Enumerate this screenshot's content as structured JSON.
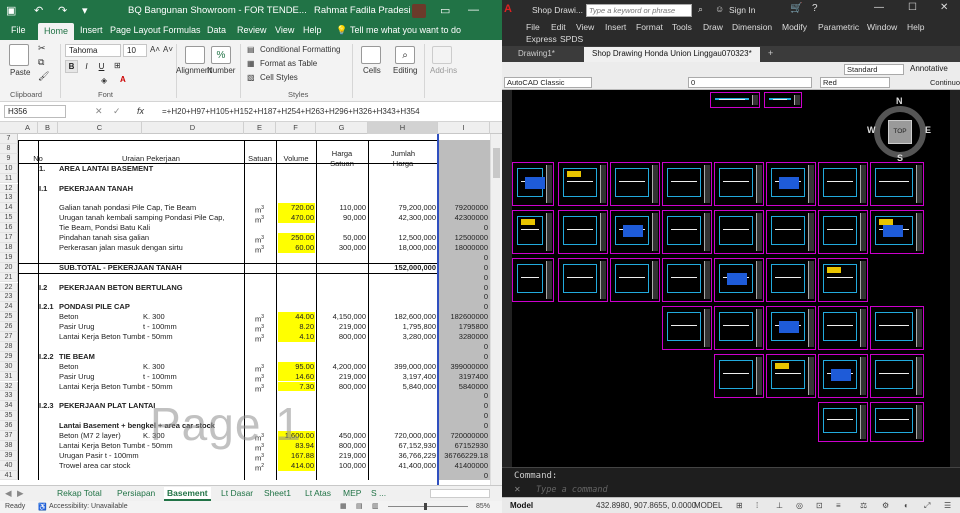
{
  "excel": {
    "title": "BQ Bangunan Showroom - FOR TENDE...",
    "user": "Rahmat Fadila Pradesi",
    "tabs": [
      "File",
      "Home",
      "Insert",
      "Page Layout",
      "Formulas",
      "Data",
      "Review",
      "View",
      "Help"
    ],
    "tell_me": "Tell me what you want to do",
    "ribbon": {
      "paste": "Paste",
      "clipboard": "Clipboard",
      "font_name": "Tahoma",
      "font_size": "10",
      "font": "Font",
      "alignment": "Alignment",
      "number": "Number",
      "cond_format": "Conditional Formatting",
      "format_table": "Format as Table",
      "cell_styles": "Cell Styles",
      "styles": "Styles",
      "cells": "Cells",
      "editing": "Editing",
      "addins": "Add-ins"
    },
    "name_box": "H356",
    "formula": "=+H20+H97+H105+H152+H187+H254+H263+H296+H326+H343+H354",
    "columns": [
      "A",
      "B",
      "C",
      "D",
      "E",
      "F",
      "G",
      "H",
      "I"
    ],
    "header": {
      "no": "No",
      "uraian": "Uraian Pekerjaan",
      "satuan": "Satuan",
      "volume": "Volume",
      "harga_satuan_1": "Harga",
      "harga_satuan_2": "Satuan",
      "jumlah_1": "Jumlah",
      "jumlah_2": "Harga"
    },
    "rows": [
      {
        "r": "7",
        "a": "",
        "b": "",
        "c": "",
        "d": "",
        "e": "",
        "f": "",
        "g": "",
        "h": "",
        "i": ""
      },
      {
        "r": "8",
        "a": "",
        "b": "",
        "c": "",
        "d": "",
        "e": "",
        "f": "",
        "g": "",
        "h": "",
        "i": ""
      },
      {
        "r": "9",
        "a": "",
        "b": "",
        "c": "",
        "d": "",
        "e": "",
        "f": "",
        "g": "",
        "h": "",
        "i": ""
      },
      {
        "r": "10",
        "a": "",
        "b": "1.",
        "c": "AREA LANTAI BASEMENT",
        "d": "",
        "e": "",
        "f": "",
        "g": "",
        "h": "",
        "i": ""
      },
      {
        "r": "11",
        "a": "",
        "b": "",
        "c": "",
        "d": "",
        "e": "",
        "f": "",
        "g": "",
        "h": "",
        "i": ""
      },
      {
        "r": "12",
        "a": "",
        "b": "I.1",
        "c": "PEKERJAAN TANAH",
        "d": "",
        "e": "",
        "f": "",
        "g": "",
        "h": "",
        "i": ""
      },
      {
        "r": "13",
        "a": "",
        "b": "",
        "c": "",
        "d": "",
        "e": "",
        "f": "",
        "g": "",
        "h": "",
        "i": ""
      },
      {
        "r": "14",
        "a": "",
        "b": "",
        "c": "Galian tanah pondasi Pile Cap, Tie Beam",
        "d": "",
        "e": "m3",
        "f": "720.00",
        "g": "110,000",
        "h": "79,200,000",
        "i": "79200000"
      },
      {
        "r": "15",
        "a": "",
        "b": "",
        "c": "Urugan tanah kembali samping Pondasi Pile Cap,",
        "d": "",
        "e": "m3",
        "f": "470.00",
        "g": "90,000",
        "h": "42,300,000",
        "i": "42300000"
      },
      {
        "r": "16",
        "a": "",
        "b": "",
        "c": "       Tie Beam, Pondsi Batu Kali",
        "d": "",
        "e": "",
        "f": "",
        "g": "",
        "h": "",
        "i": "0"
      },
      {
        "r": "17",
        "a": "",
        "b": "",
        "c": "Pindahan tanah sisa galian",
        "d": "",
        "e": "m3",
        "f": "250.00",
        "g": "50,000",
        "h": "12,500,000",
        "i": "12500000"
      },
      {
        "r": "18",
        "a": "",
        "b": "",
        "c": "Perkerasan jalan masuk dengan sirtu",
        "d": "",
        "e": "m3",
        "f": "60.00",
        "g": "300,000",
        "h": "18,000,000",
        "i": "18000000"
      },
      {
        "r": "19",
        "a": "",
        "b": "",
        "c": "",
        "d": "",
        "e": "",
        "f": "",
        "g": "",
        "h": "",
        "i": "0"
      },
      {
        "r": "20",
        "a": "",
        "b": "",
        "c": "SUB.TOTAL  -  PEKERJAAN TANAH",
        "d": "",
        "e": "",
        "f": "",
        "g": "",
        "h": "152,000,000",
        "i": "0"
      },
      {
        "r": "21",
        "a": "",
        "b": "",
        "c": "",
        "d": "",
        "e": "",
        "f": "",
        "g": "",
        "h": "",
        "i": "0"
      },
      {
        "r": "22",
        "a": "",
        "b": "I.2",
        "c": "PEKERJAAN BETON BERTULANG",
        "d": "",
        "e": "",
        "f": "",
        "g": "",
        "h": "",
        "i": "0"
      },
      {
        "r": "23",
        "a": "",
        "b": "",
        "c": "",
        "d": "",
        "e": "",
        "f": "",
        "g": "",
        "h": "",
        "i": "0"
      },
      {
        "r": "24",
        "a": "",
        "b": "I.2.1",
        "c": "PONDASI PILE CAP",
        "d": "",
        "e": "",
        "f": "",
        "g": "",
        "h": "",
        "i": "0"
      },
      {
        "r": "25",
        "a": "",
        "b": "",
        "c": "     Beton",
        "d": "K. 300",
        "e": "m3",
        "f": "44.00",
        "g": "4,150,000",
        "h": "182,600,000",
        "i": "182600000"
      },
      {
        "r": "26",
        "a": "",
        "b": "",
        "c": "     Pasir Urug",
        "d": "t - 100mm",
        "e": "m3",
        "f": "8.20",
        "g": "219,000",
        "h": "1,795,800",
        "i": "1795800"
      },
      {
        "r": "27",
        "a": "",
        "b": "",
        "c": "     Lantai Kerja Beton Tumbuk",
        "d": "t -  50mm",
        "e": "m3",
        "f": "4.10",
        "g": "800,000",
        "h": "3,280,000",
        "i": "3280000"
      },
      {
        "r": "28",
        "a": "",
        "b": "",
        "c": "",
        "d": "",
        "e": "",
        "f": "",
        "g": "",
        "h": "",
        "i": "0"
      },
      {
        "r": "29",
        "a": "",
        "b": "I.2.2",
        "c": "TIE BEAM",
        "d": "",
        "e": "",
        "f": "",
        "g": "",
        "h": "",
        "i": "0"
      },
      {
        "r": "30",
        "a": "",
        "b": "",
        "c": "     Beton",
        "d": "K. 300",
        "e": "m3",
        "f": "95.00",
        "g": "4,200,000",
        "h": "399,000,000",
        "i": "399000000"
      },
      {
        "r": "31",
        "a": "",
        "b": "",
        "c": "     Pasir Urug",
        "d": "t - 100mm",
        "e": "m3",
        "f": "14.60",
        "g": "219,000",
        "h": "3,197,400",
        "i": "3197400"
      },
      {
        "r": "32",
        "a": "",
        "b": "",
        "c": "     Lantai Kerja Beton Tumbuk",
        "d": "t -  50mm",
        "e": "m3",
        "f": "7.30",
        "g": "800,000",
        "h": "5,840,000",
        "i": "5840000"
      },
      {
        "r": "33",
        "a": "",
        "b": "",
        "c": "",
        "d": "",
        "e": "",
        "f": "",
        "g": "",
        "h": "",
        "i": "0"
      },
      {
        "r": "34",
        "a": "",
        "b": "I.2.3",
        "c": "PEKERJAAN PLAT LANTAI",
        "d": "",
        "e": "",
        "f": "",
        "g": "",
        "h": "",
        "i": "0"
      },
      {
        "r": "35",
        "a": "",
        "b": "",
        "c": "",
        "d": "",
        "e": "",
        "f": "",
        "g": "",
        "h": "",
        "i": "0"
      },
      {
        "r": "36",
        "a": "",
        "b": "",
        "c": "Lantai Basement + bengkel + area car stock",
        "d": "",
        "e": "",
        "f": "",
        "g": "",
        "h": "",
        "i": "0"
      },
      {
        "r": "37",
        "a": "",
        "b": "",
        "c": "     Beton (M7 2 layer)",
        "d": "K. 300",
        "e": "m3",
        "f": "1,600.00",
        "g": "450,000",
        "h": "720,000,000",
        "i": "720000000"
      },
      {
        "r": "38",
        "a": "",
        "b": "",
        "c": "     Lantai Kerja Beton Tumbuk",
        "d": "t - 50mm",
        "e": "m3",
        "f": "83.94",
        "g": "800,000",
        "h": "67,152,930",
        "i": "67152930"
      },
      {
        "r": "39",
        "a": "",
        "b": "",
        "c": "     Urugan Pasir t - 100mm",
        "d": "",
        "e": "m3",
        "f": "167.88",
        "g": "219,000",
        "h": "36,766,229",
        "i": "36766229.18"
      },
      {
        "r": "40",
        "a": "",
        "b": "",
        "c": "     Trowel area car stock",
        "d": "",
        "e": "m2",
        "f": "414.00",
        "g": "100,000",
        "h": "41,400,000",
        "i": "41400000"
      },
      {
        "r": "41",
        "a": "",
        "b": "",
        "c": "",
        "d": "",
        "e": "",
        "f": "",
        "g": "",
        "h": "",
        "i": "0"
      }
    ],
    "watermark": "Page 1",
    "sheet_tabs": [
      "Rekap Total",
      "Persiapan",
      "Basement",
      "Lt Dasar",
      "Sheet1",
      "Lt Atas",
      "MEP",
      "S ..."
    ],
    "active_sheet": "Basement",
    "status_ready": "Ready",
    "status_accessibility": "Accessibility: Unavailable",
    "zoom": "85%"
  },
  "autocad": {
    "title": "Shop Drawi...",
    "search_placeholder": "Type a keyword or phrase",
    "sign_in": "Sign In",
    "menu": [
      "File",
      "Edit",
      "View",
      "Insert",
      "Format",
      "Tools",
      "Draw",
      "Dimension",
      "Modify",
      "Parametric",
      "Window",
      "Help",
      "Express",
      "SPDS"
    ],
    "doc_tabs": [
      "Drawing1*",
      "Shop Drawing Honda Union Linggau070323*"
    ],
    "workspace": "AutoCAD Classic",
    "layer": "0",
    "color": "Red",
    "style": "Standard",
    "annotative": "Annotative",
    "linetype": "Continuo",
    "compass": {
      "n": "N",
      "s": "S",
      "e": "E",
      "w": "W",
      "top": "TOP"
    },
    "command_label": "Command:",
    "command_placeholder": "Type a command",
    "coords": "432.8980, 907.8655, 0.0000",
    "model_label": "MODEL",
    "model_tab": "Model",
    "accent": "#cc00cc"
  }
}
